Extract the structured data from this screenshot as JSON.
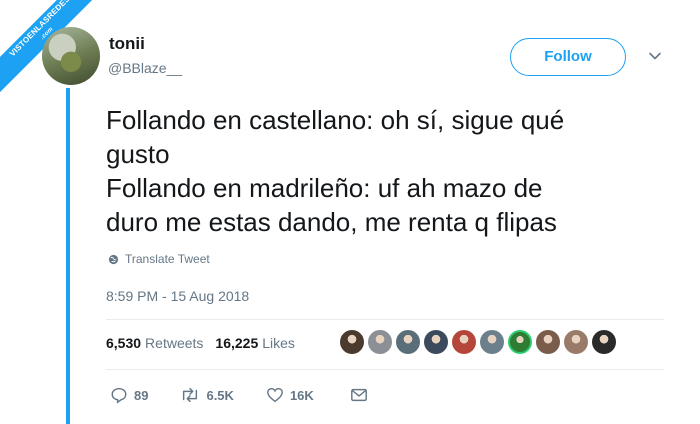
{
  "ribbon": {
    "text": "VISTOENLASREDES",
    "sub": ".com"
  },
  "user": {
    "name": "tonii",
    "handle": "@BBlaze__"
  },
  "follow_label": "Follow",
  "tweet": {
    "lines": [
      "Follando en castellano: oh sí, sigue qué",
      "gusto",
      "Follando en madrileño: uf ah mazo de",
      "duro me estas dando, me renta q flipas"
    ]
  },
  "translate_label": "Translate Tweet",
  "timestamp": "8:59 PM - 15 Aug 2018",
  "stats": {
    "retweets_count": "6,530",
    "retweets_label": "Retweets",
    "likes_count": "16,225",
    "likes_label": "Likes"
  },
  "likers": [
    {
      "color": "#4a3b2e"
    },
    {
      "color": "#8c8f96"
    },
    {
      "color": "#5a6e7a"
    },
    {
      "color": "#3b4a5c"
    },
    {
      "color": "#b5473a"
    },
    {
      "color": "#6b7f8c"
    },
    {
      "color": "#2e7d32"
    },
    {
      "color": "#7a5c4a"
    },
    {
      "color": "#9a7b6a"
    },
    {
      "color": "#2a2a2a"
    }
  ],
  "actions": {
    "replies": "89",
    "retweets": "6.5K",
    "likes": "16K"
  },
  "colors": {
    "accent": "#1da1f2",
    "muted": "#657786",
    "text": "#14171a"
  }
}
